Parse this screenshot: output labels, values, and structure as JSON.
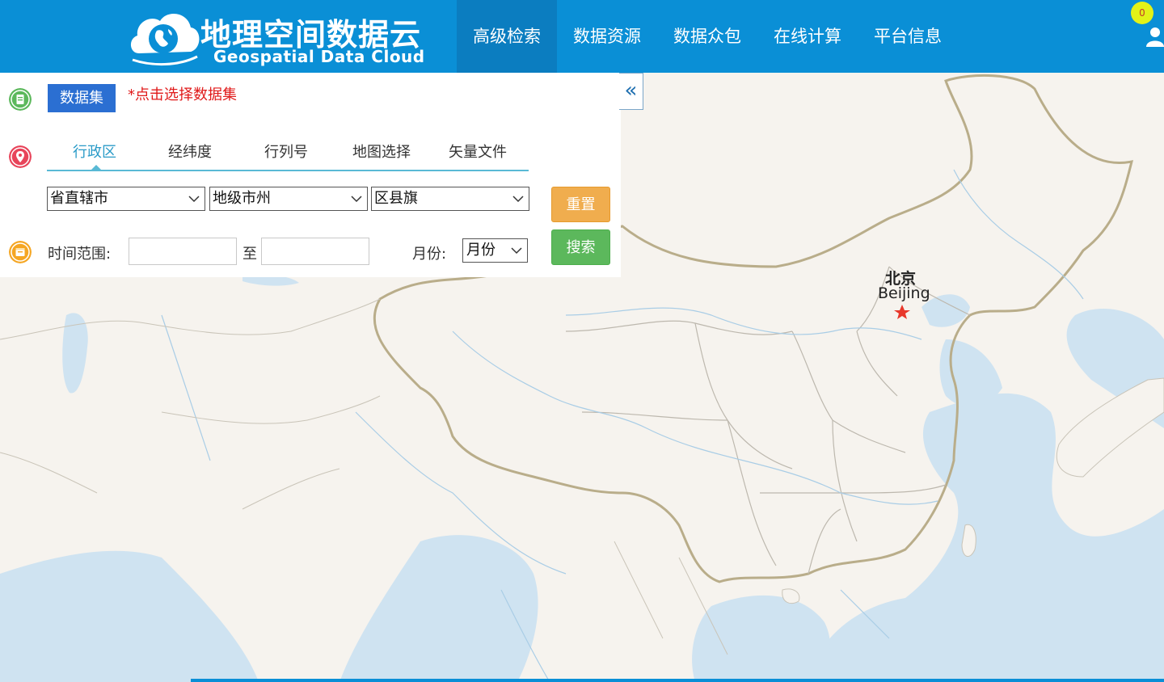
{
  "header": {
    "logo_cn": "地理空间数据云",
    "logo_en": "Geospatial Data Cloud",
    "nav": [
      "高级检索",
      "数据资源",
      "数据众包",
      "在线计算",
      "平台信息"
    ],
    "cart_count": "0"
  },
  "panel": {
    "dataset_button": "数据集",
    "dataset_hint": "*点击选择数据集",
    "tabs": [
      "行政区",
      "经纬度",
      "行列号",
      "地图选择",
      "矢量文件"
    ],
    "active_tab": "行政区",
    "province": "省直辖市",
    "city": "地级市州",
    "county": "区县旗",
    "time_label": "时间范围:",
    "time_to": "至",
    "time_start": "",
    "time_end": "",
    "month_label": "月份:",
    "month_value": "月份",
    "reset_button": "重置",
    "search_button": "搜索",
    "collapse": "«"
  },
  "map": {
    "capital_cn": "北京",
    "capital_en": "Beijing"
  },
  "colors": {
    "header": "#0a8fd6",
    "active_nav": "#0b7dc0",
    "land": "#f6f3ee",
    "water": "#cfe3f1",
    "reset": "#f0ad4e",
    "search": "#5cb85c",
    "dataset": "#2b6fd2",
    "hint": "#e01a1a"
  }
}
